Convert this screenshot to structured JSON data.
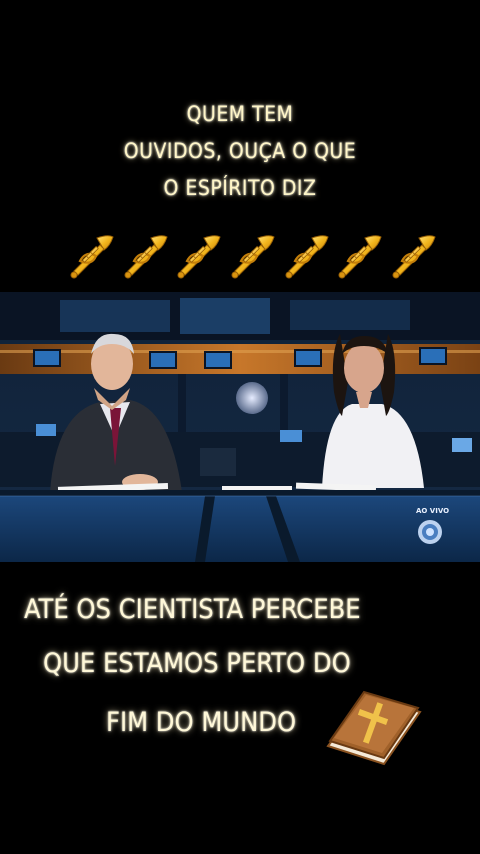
{
  "top_caption": {
    "lines": [
      "QUEM TEM",
      "OUVIDOS, OUÇA O QUE",
      "O ESPÍRITO DIZ"
    ]
  },
  "emoji_row": {
    "icon": "trumpet-icon",
    "count": 7
  },
  "video": {
    "live_label": "AO VIVO",
    "channel_logo": "record-logo"
  },
  "bottom_caption": {
    "lines": [
      "ATÉ OS CIENTISTA PERCEBE",
      "QUE ESTAMOS PERTO DO",
      "FIM DO MUNDO"
    ],
    "icon": "bible-icon"
  },
  "colors": {
    "background": "#000000",
    "caption_text": "#fff6c8",
    "trumpet_gold": "#f2b51c",
    "bible_brown": "#a0612a"
  }
}
